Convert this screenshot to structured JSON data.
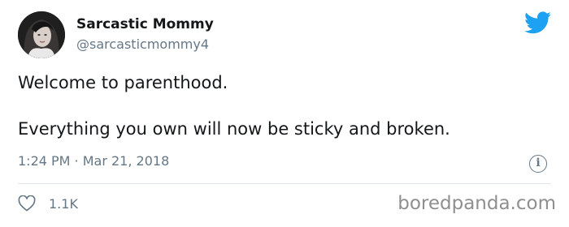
{
  "author": {
    "display_name": "Sarcastic Mommy",
    "handle": "@sarcasticmommy4"
  },
  "tweet": {
    "lines": [
      "Welcome to parenthood.",
      "Everything you own will now be sticky and broken."
    ],
    "timestamp": "1:24 PM · Mar 21, 2018"
  },
  "engagement": {
    "likes": "1.1K"
  },
  "icons": {
    "platform": "twitter-bird-icon",
    "info": "info-icon",
    "like": "heart-icon"
  },
  "colors": {
    "twitter_blue": "#1da1f2",
    "secondary_text": "#657786",
    "primary_text": "#14171a",
    "divider": "#e1e8ed"
  },
  "watermark": "boredpanda.com"
}
